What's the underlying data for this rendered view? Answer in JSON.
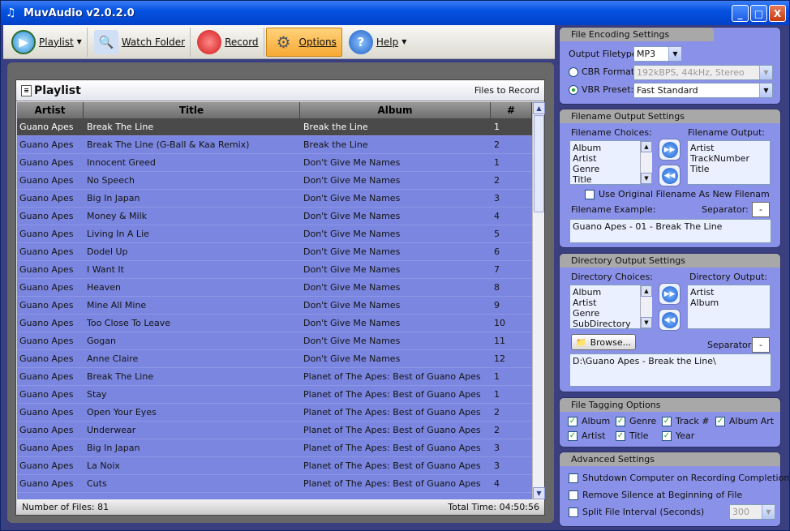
{
  "window": {
    "title": "MuvAudio v2.0.2.0",
    "min": "_",
    "max": "□",
    "close": "X"
  },
  "toolbar": {
    "playlist": "Playlist",
    "watch_folder": "Watch Folder",
    "record": "Record",
    "options": "Options",
    "help": "Help"
  },
  "playlist": {
    "title": "Playlist",
    "files_to_record": "Files to Record",
    "columns": [
      "Artist",
      "Title",
      "Album",
      "#"
    ],
    "rows": [
      [
        "Guano Apes",
        "Break The Line",
        "Break the Line",
        "1"
      ],
      [
        "Guano Apes",
        "Break The Line (G-Ball & Kaa Remix)",
        "Break the Line",
        "2"
      ],
      [
        "Guano Apes",
        "Innocent Greed",
        "Don't Give Me Names",
        "1"
      ],
      [
        "Guano Apes",
        "No Speech",
        "Don't Give Me Names",
        "2"
      ],
      [
        "Guano Apes",
        "Big In Japan",
        "Don't Give Me Names",
        "3"
      ],
      [
        "Guano Apes",
        "Money & Milk",
        "Don't Give Me Names",
        "4"
      ],
      [
        "Guano Apes",
        "Living In A Lie",
        "Don't Give Me Names",
        "5"
      ],
      [
        "Guano Apes",
        "Dodel Up",
        "Don't Give Me Names",
        "6"
      ],
      [
        "Guano Apes",
        "I Want It",
        "Don't Give Me Names",
        "7"
      ],
      [
        "Guano Apes",
        "Heaven",
        "Don't Give Me Names",
        "8"
      ],
      [
        "Guano Apes",
        "Mine All Mine",
        "Don't Give Me Names",
        "9"
      ],
      [
        "Guano Apes",
        "Too Close To Leave",
        "Don't Give Me Names",
        "10"
      ],
      [
        "Guano Apes",
        "Gogan",
        "Don't Give Me Names",
        "11"
      ],
      [
        "Guano Apes",
        "Anne Claire",
        "Don't Give Me Names",
        "12"
      ],
      [
        "Guano Apes",
        "Break The Line",
        "Planet of The Apes: Best of Guano Apes",
        "1"
      ],
      [
        "Guano Apes",
        "Stay",
        "Planet of The Apes: Best of Guano Apes",
        "1"
      ],
      [
        "Guano Apes",
        "Open Your Eyes",
        "Planet of The Apes: Best of Guano Apes",
        "2"
      ],
      [
        "Guano Apes",
        "Underwear",
        "Planet of The Apes: Best of Guano Apes",
        "2"
      ],
      [
        "Guano Apes",
        "Big In Japan",
        "Planet of The Apes: Best of Guano Apes",
        "3"
      ],
      [
        "Guano Apes",
        "La Noix",
        "Planet of The Apes: Best of Guano Apes",
        "3"
      ],
      [
        "Guano Apes",
        "Cuts",
        "Planet of The Apes: Best of Guano Apes",
        "4"
      ]
    ],
    "selected_row": 0,
    "number_of_files": "Number of Files: 81",
    "total_time": "Total Time: 04:50:56"
  },
  "encoding": {
    "title": "File Encoding Settings",
    "output_filetype_label": "Output Filetype:",
    "output_filetype": "MP3",
    "cbr_label": "CBR Format:",
    "cbr_value": "192kBPS, 44kHz, Stereo",
    "vbr_label": "VBR Preset:",
    "vbr_value": "Fast Standard",
    "selected": "vbr"
  },
  "filename": {
    "title": "Filename Output Settings",
    "choices_label": "Filename Choices:",
    "choices": [
      "Album",
      "Artist",
      "Genre",
      "Title"
    ],
    "output_label": "Filename Output:",
    "output": [
      "Artist",
      "TrackNumber",
      "Title"
    ],
    "use_original": "Use Original Filename As New Filenam",
    "example_label": "Filename Example:",
    "separator_label": "Separator:",
    "separator": "-",
    "example": "Guano Apes - 01 - Break The Line"
  },
  "directory": {
    "title": "Directory Output Settings",
    "choices_label": "Directory Choices:",
    "choices": [
      "Album",
      "Artist",
      "Genre",
      "SubDirectory"
    ],
    "output_label": "Directory Output:",
    "output": [
      "Artist",
      "Album"
    ],
    "browse": "Browse...",
    "separator_label": "Separator:",
    "separator": "-",
    "example": "D:\\Guano Apes - Break the Line\\"
  },
  "tagging": {
    "title": "File Tagging Options",
    "items": [
      "Album",
      "Genre",
      "Track #",
      "Album Art",
      "Artist",
      "Title",
      "Year"
    ]
  },
  "advanced": {
    "title": "Advanced Settings",
    "shutdown": "Shutdown Computer on Recording Completion",
    "silence": "Remove Silence at Beginning of File",
    "split": "Split File Interval (Seconds)",
    "split_value": "300"
  }
}
